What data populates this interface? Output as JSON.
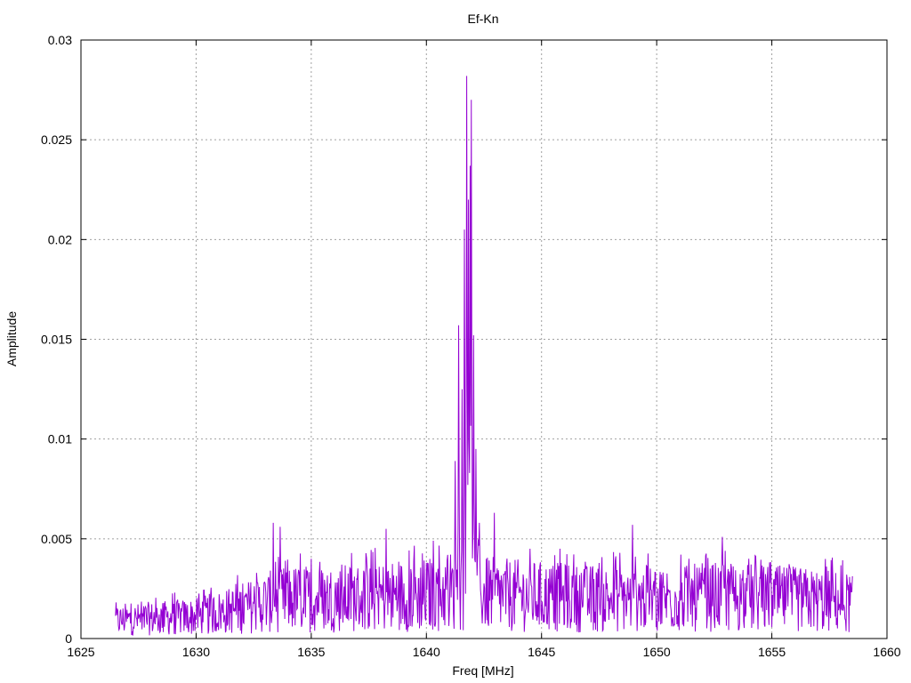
{
  "chart_data": {
    "type": "line",
    "title": "Ef-Kn",
    "xlabel": "Freq [MHz]",
    "ylabel": "Amplitude",
    "xlim": [
      1625,
      1660
    ],
    "ylim": [
      0,
      0.03
    ],
    "x_ticks": [
      1625,
      1630,
      1635,
      1640,
      1645,
      1650,
      1655,
      1660
    ],
    "y_ticks": [
      0,
      0.005,
      0.01,
      0.015,
      0.02,
      0.025,
      0.03
    ],
    "x_tick_labels": [
      "1625",
      "1630",
      "1635",
      "1640",
      "1645",
      "1650",
      "1655",
      "1660"
    ],
    "y_tick_labels": [
      "0",
      "0.005",
      "0.01",
      "0.015",
      "0.02",
      "0.025",
      "0.03"
    ],
    "grid": true,
    "series": [
      {
        "color": "#9400d3",
        "x_start": 1626.5,
        "x_end": 1658.5,
        "noise_profile": [
          [
            1626.5,
            0.0009
          ],
          [
            1628,
            0.001
          ],
          [
            1630,
            0.0011
          ],
          [
            1632,
            0.0015
          ],
          [
            1633,
            0.0018
          ],
          [
            1634,
            0.002
          ],
          [
            1636,
            0.002
          ],
          [
            1638,
            0.0021
          ],
          [
            1640,
            0.0022
          ],
          [
            1641,
            0.0024
          ],
          [
            1643,
            0.0022
          ],
          [
            1645,
            0.0021
          ],
          [
            1647,
            0.002
          ],
          [
            1649,
            0.002
          ],
          [
            1651,
            0.002
          ],
          [
            1653,
            0.0021
          ],
          [
            1655,
            0.002
          ],
          [
            1657,
            0.0019
          ],
          [
            1658.5,
            0.0018
          ]
        ],
        "peaks": [
          [
            1633.35,
            0.0058
          ],
          [
            1633.65,
            0.0056
          ],
          [
            1635.0,
            0.004
          ],
          [
            1638.25,
            0.0055
          ],
          [
            1641.25,
            0.0089
          ],
          [
            1641.4,
            0.0157
          ],
          [
            1641.55,
            0.0125
          ],
          [
            1641.65,
            0.0205
          ],
          [
            1641.75,
            0.0282
          ],
          [
            1641.82,
            0.022
          ],
          [
            1641.9,
            0.0237
          ],
          [
            1641.95,
            0.027
          ],
          [
            1642.05,
            0.0152
          ],
          [
            1642.15,
            0.0095
          ],
          [
            1642.3,
            0.0058
          ],
          [
            1642.95,
            0.0063
          ],
          [
            1644.5,
            0.0045
          ],
          [
            1645.8,
            0.0045
          ],
          [
            1648.95,
            0.0057
          ],
          [
            1652.85,
            0.0051
          ],
          [
            1654.0,
            0.004
          ]
        ]
      }
    ]
  }
}
